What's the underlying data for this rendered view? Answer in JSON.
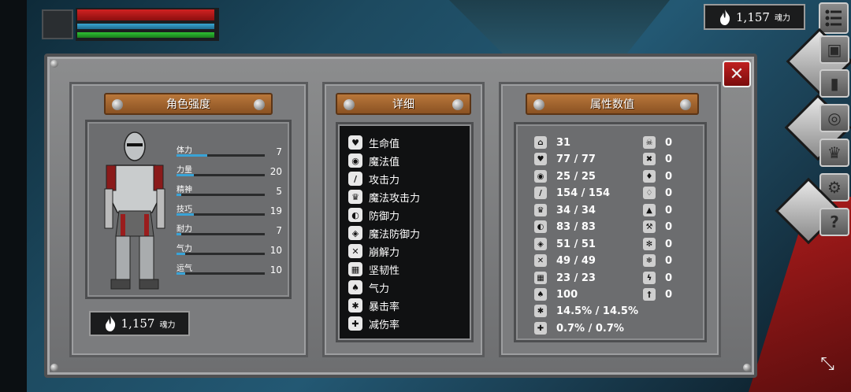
{
  "hud": {
    "soul_value": "1,157",
    "soul_unit": "魂力"
  },
  "panel": {
    "left_title": "角色强度",
    "mid_title": "详细",
    "right_title": "属性数值",
    "close_icon": "close-x-icon"
  },
  "character_stats": [
    {
      "label": "体力",
      "value": "7",
      "fill": 0.35
    },
    {
      "label": "力量",
      "value": "20",
      "fill": 0.2
    },
    {
      "label": "精神",
      "value": "5",
      "fill": 0.05
    },
    {
      "label": "技巧",
      "value": "19",
      "fill": 0.2
    },
    {
      "label": "耐力",
      "value": "7",
      "fill": 0.05
    },
    {
      "label": "气力",
      "value": "10",
      "fill": 0.1
    },
    {
      "label": "运气",
      "value": "10",
      "fill": 0.1
    }
  ],
  "character_soul": {
    "value": "1,157",
    "unit": "魂力"
  },
  "details": [
    {
      "label": "生命值",
      "icon": "heart-icon"
    },
    {
      "label": "魔法值",
      "icon": "brain-icon"
    },
    {
      "label": "攻击力",
      "icon": "sword-icon"
    },
    {
      "label": "魔法攻击力",
      "icon": "magic-crown-icon"
    },
    {
      "label": "防御力",
      "icon": "shield-icon"
    },
    {
      "label": "魔法防御力",
      "icon": "magic-shield-icon"
    },
    {
      "label": "崩解力",
      "icon": "crossed-swords-icon"
    },
    {
      "label": "坚韧性",
      "icon": "helmet-icon"
    },
    {
      "label": "气力",
      "icon": "lungs-icon"
    },
    {
      "label": "暴击率",
      "icon": "burst-icon"
    },
    {
      "label": "减伤率",
      "icon": "shield-plus-icon"
    }
  ],
  "attributes_left": [
    {
      "icon": "level-icon",
      "value": "31"
    },
    {
      "icon": "heart-icon",
      "value": "77 / 77"
    },
    {
      "icon": "brain-icon",
      "value": "25 / 25"
    },
    {
      "icon": "sword-icon",
      "value": "154 / 154"
    },
    {
      "icon": "magic-crown-icon",
      "value": "34 / 34"
    },
    {
      "icon": "shield-icon",
      "value": "83 / 83"
    },
    {
      "icon": "magic-shield-icon",
      "value": "51 / 51"
    },
    {
      "icon": "crossed-swords-icon",
      "value": "49 / 49"
    },
    {
      "icon": "helmet-icon",
      "value": "23 / 23"
    },
    {
      "icon": "lungs-icon",
      "value": "100"
    },
    {
      "icon": "burst-icon",
      "value": "14.5% / 14.5%"
    },
    {
      "icon": "shield-plus-icon",
      "value": "0.7% / 0.7%"
    }
  ],
  "attributes_right": [
    {
      "icon": "skull-icon",
      "value": "0"
    },
    {
      "icon": "bones-icon",
      "value": "0"
    },
    {
      "icon": "drop-icon",
      "value": "0"
    },
    {
      "icon": "bleed-icon",
      "value": "0"
    },
    {
      "icon": "fire-icon",
      "value": "0"
    },
    {
      "icon": "hammer-icon",
      "value": "0"
    },
    {
      "icon": "frost-icon",
      "value": "0"
    },
    {
      "icon": "snowflake-icon",
      "value": "0"
    },
    {
      "icon": "lightning-icon",
      "value": "0"
    },
    {
      "icon": "dagger-icon",
      "value": "0"
    }
  ],
  "side_buttons": [
    "menu-icon",
    "character-icon",
    "backpack-icon",
    "door-icon",
    "eye-icon",
    "coin-icon",
    "crown-icon",
    "gear-icon",
    "help-icon"
  ],
  "colors": {
    "hp": "#d12222",
    "mp": "#3aa6d1",
    "stamina": "#2fc233",
    "plank": "#b9773a",
    "stat_bar": "#39a3d6"
  }
}
